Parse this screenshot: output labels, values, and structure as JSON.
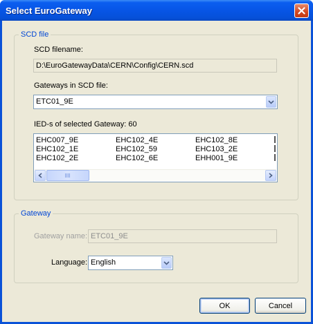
{
  "window": {
    "title": "Select EuroGateway"
  },
  "scd_group": {
    "legend": "SCD file",
    "filename_label": "SCD filename:",
    "filename_value": "D:\\EuroGatewayData\\CERN\\Config\\CERN.scd",
    "gateways_label": "Gateways in SCD file:",
    "gateway_selected": "ETC01_9E",
    "ieds_label": "IED-s of selected Gateway: 60",
    "ied_columns": [
      [
        "EHC007_9E",
        "EHC102_1E",
        "EHC102_2E"
      ],
      [
        "EHC102_4E",
        "EHC102_59",
        "EHC102_6E"
      ],
      [
        "EHC102_8E",
        "EHC103_2E",
        "EHH001_9E"
      ]
    ]
  },
  "gateway_group": {
    "legend": "Gateway",
    "name_label": "Gateway name:",
    "name_value": "ETC01_9E",
    "language_label": "Language:",
    "language_value": "English"
  },
  "buttons": {
    "ok": "OK",
    "cancel": "Cancel"
  },
  "icons": {
    "close": "close-icon",
    "dropdown": "chevron-down-icon",
    "scroll_left": "arrow-left-icon",
    "scroll_right": "arrow-right-icon"
  },
  "colors": {
    "titlebar": "#0755e6",
    "group_legend": "#0046d5",
    "dialog_bg": "#ece9d8"
  }
}
